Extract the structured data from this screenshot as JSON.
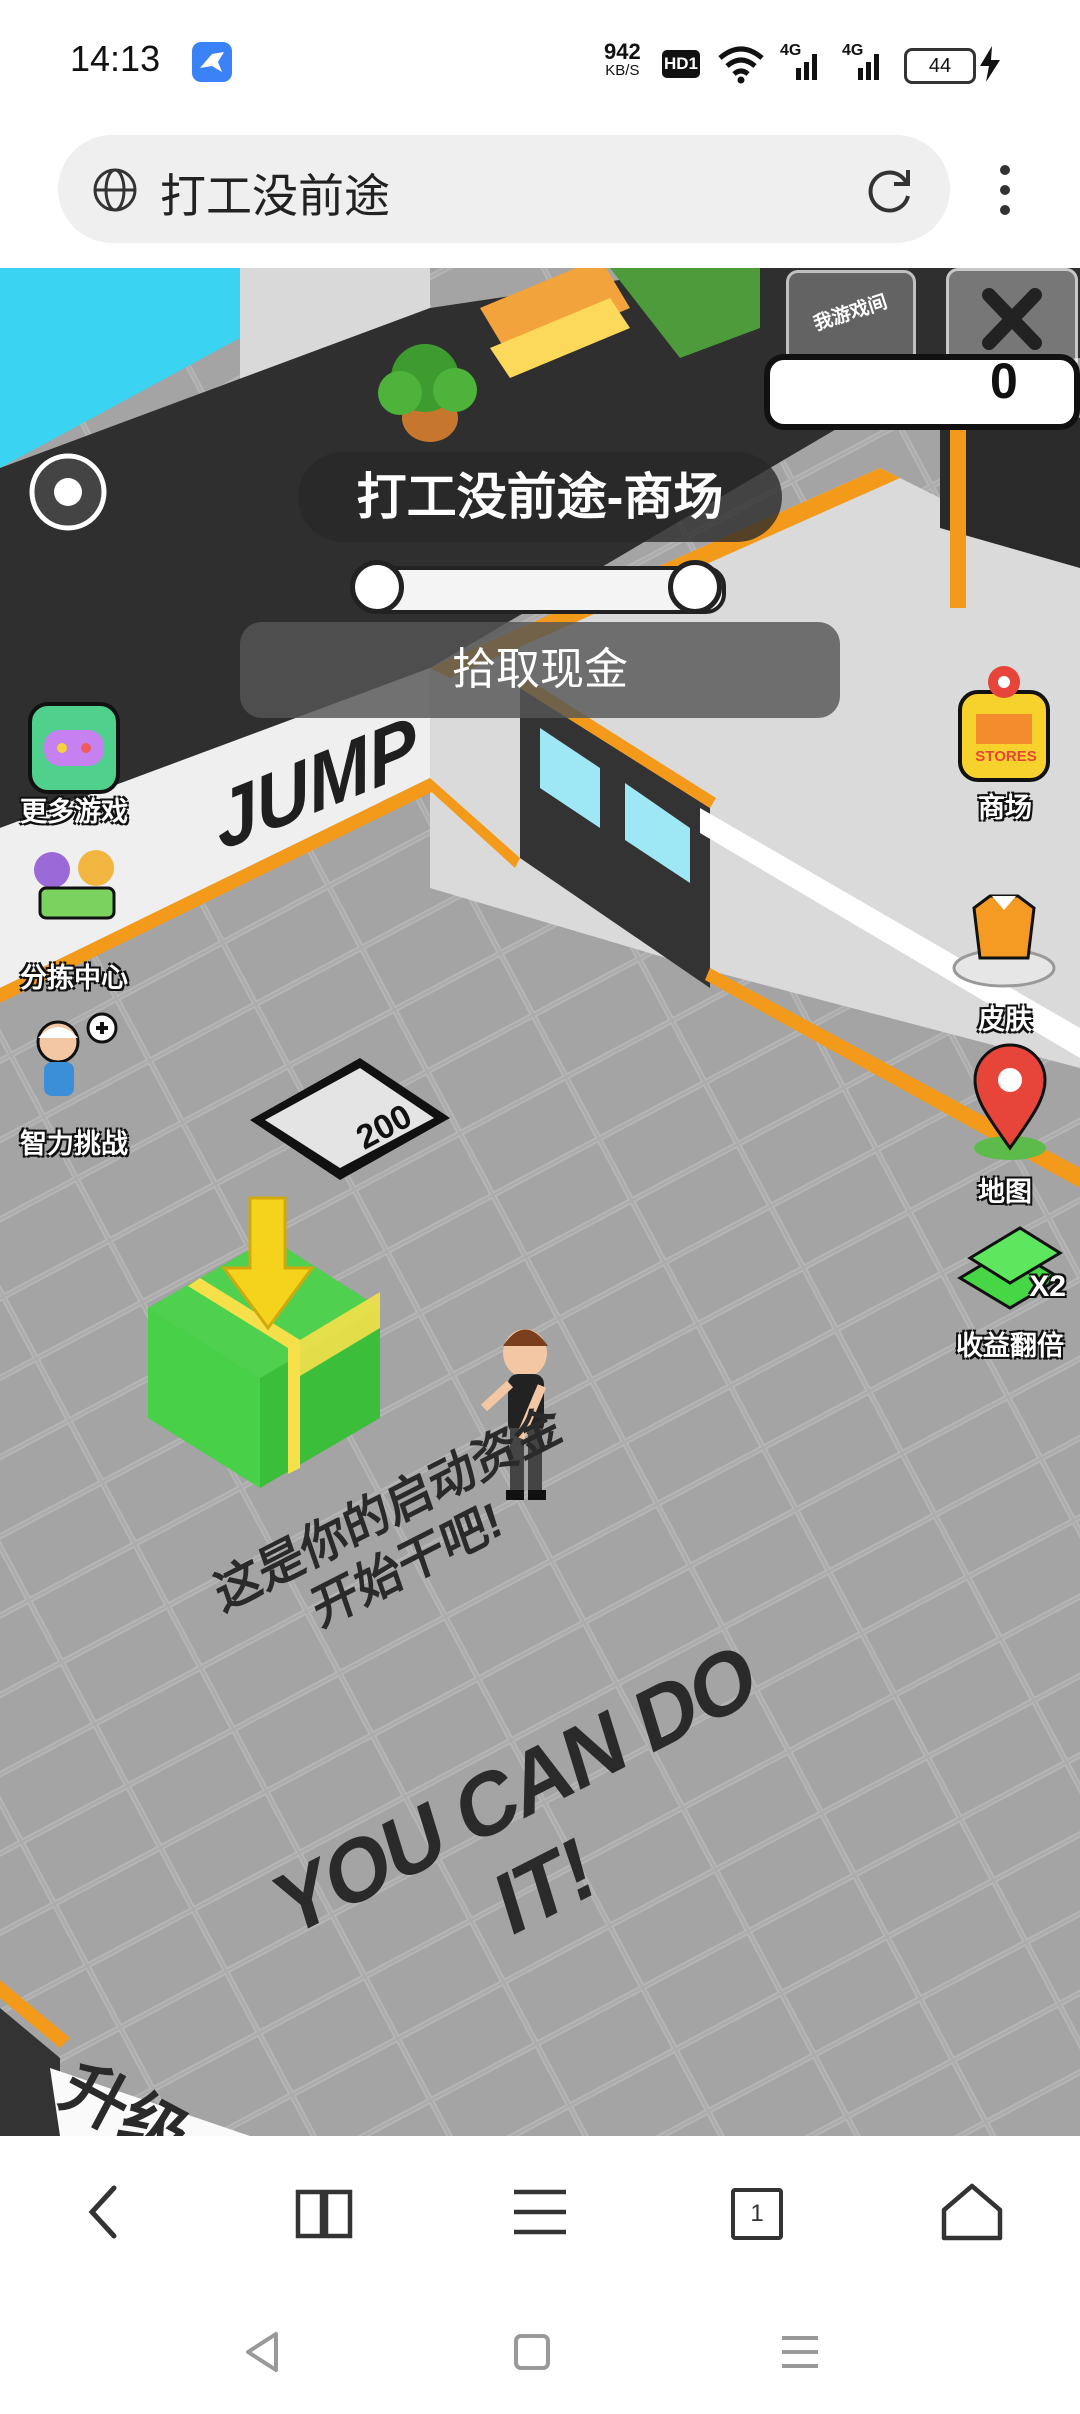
{
  "status_bar": {
    "time": "14:13",
    "net_speed_value": "942",
    "net_speed_unit": "KB/S",
    "hd_badge": "HD1",
    "signal_1": "4G",
    "signal_2": "4G",
    "battery": "44"
  },
  "browser": {
    "address_text": "打工没前途"
  },
  "game": {
    "title": "打工没前途-商场",
    "task_text": "拾取现金",
    "money_count": "0",
    "promo_text": "我游戏间",
    "progress_fraction": 0.0,
    "left_menu": [
      {
        "label": "更多游戏"
      },
      {
        "label": "分拣中心"
      },
      {
        "label": "智力挑战"
      }
    ],
    "right_menu": [
      {
        "label": "商场",
        "icon_text": "STORES"
      },
      {
        "label": "皮肤"
      },
      {
        "label": "地图"
      },
      {
        "label": "收益翻倍",
        "badge": "X2"
      }
    ],
    "price_tag": "200",
    "floor_message": [
      "这是你的启动资金",
      "开始干吧!"
    ],
    "floor_slogan": "YOU CAN DO IT!",
    "wall_text": "JUMP",
    "floor_upgrade_text": "升级"
  },
  "colors": {
    "accent_orange": "#f39a1b",
    "floor_gray": "#a8a8a8",
    "wall_dark": "#2f2f2f",
    "cash_green": "#46d646"
  },
  "bottom_nav": {
    "tab_count": "1"
  }
}
